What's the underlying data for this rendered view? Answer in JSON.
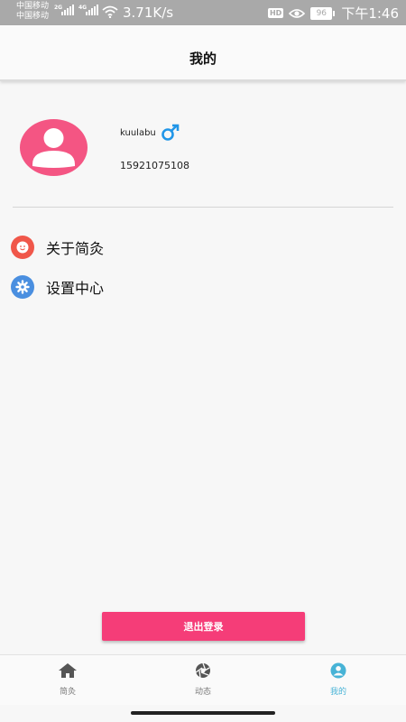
{
  "status_bar": {
    "carrier_1": "中国移动",
    "carrier_2": "中国移动",
    "net_1": "2G",
    "net_2": "4G",
    "speed": "3.71K/s",
    "hd": "HD",
    "battery": "96",
    "time": "下午1:46"
  },
  "header": {
    "title": "我的"
  },
  "profile": {
    "username": "kuulabu",
    "gender_icon": "male-icon",
    "phone": "15921075108",
    "avatar_color": "#f45583"
  },
  "menu": {
    "items": [
      {
        "label": "关于简灸",
        "icon": "smile-icon",
        "color": "#f0574a"
      },
      {
        "label": "设置中心",
        "icon": "gear-icon",
        "color": "#4a8fe0"
      }
    ]
  },
  "logout": {
    "label": "退出登录",
    "color": "#f53d78"
  },
  "bottom_nav": {
    "items": [
      {
        "label": "简灸",
        "icon": "home-icon",
        "active": false
      },
      {
        "label": "动态",
        "icon": "aperture-icon",
        "active": false
      },
      {
        "label": "我的",
        "icon": "profile-icon",
        "active": true
      }
    ],
    "active_color": "#47b3d6"
  }
}
